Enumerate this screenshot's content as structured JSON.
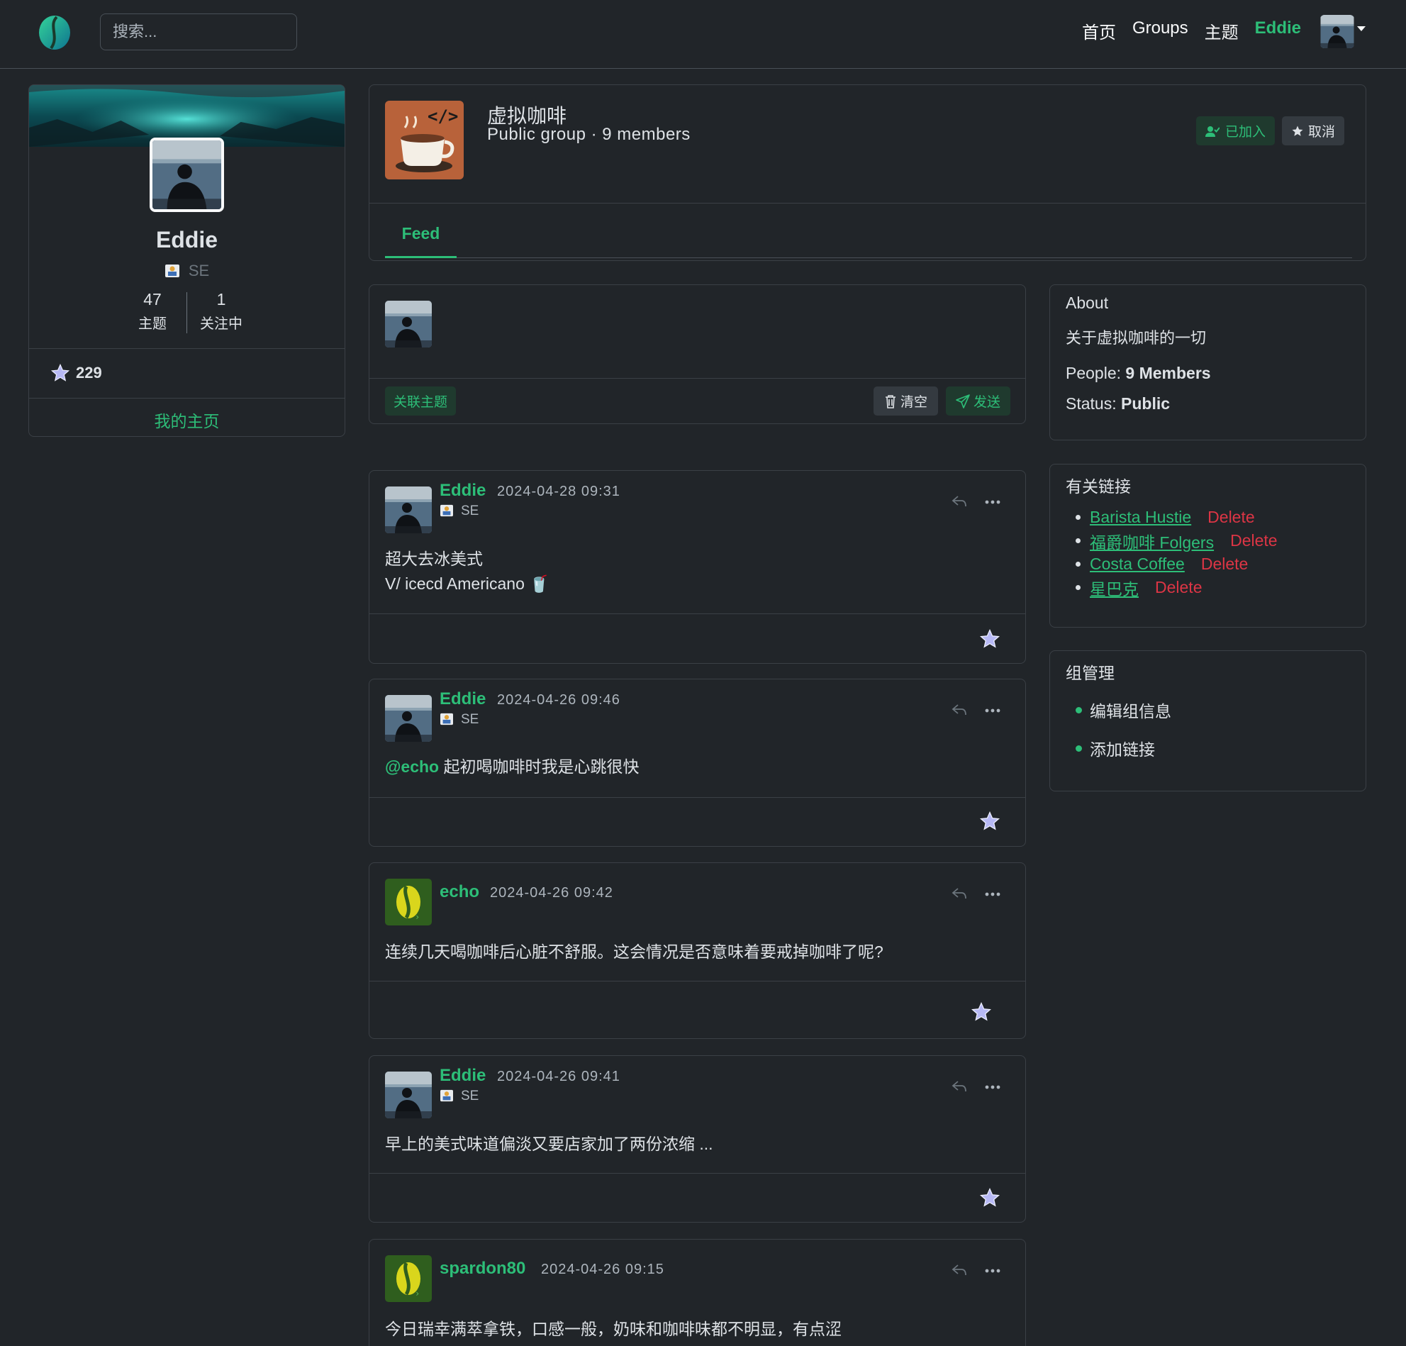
{
  "nav": {
    "search_placeholder": "搜索...",
    "links": [
      "首页",
      "Groups",
      "主题",
      "Eddie"
    ]
  },
  "profile": {
    "name": "Eddie",
    "role": "SE",
    "stats": [
      {
        "value": "47",
        "label": "主题"
      },
      {
        "value": "1",
        "label": "关注中"
      }
    ],
    "stars": "229",
    "homepage_label": "我的主页"
  },
  "group": {
    "title": "虚拟咖啡",
    "subtitle": "Public group · 9 members",
    "joined_label": "已加入",
    "cancel_label": "取消",
    "tab_feed": "Feed"
  },
  "composer": {
    "topic_label": "关联主题",
    "clear_label": "清空",
    "send_label": "发送"
  },
  "posts": [
    {
      "author": "Eddie",
      "time": "2024-04-28 09:31",
      "role": "SE",
      "lines": [
        "超大去冰美式",
        "V/ icecd Americano 🥤"
      ]
    },
    {
      "author": "Eddie",
      "time": "2024-04-26 09:46",
      "role": "SE",
      "mention": "@echo",
      "text": "起初喝咖啡时我是心跳很快"
    },
    {
      "author": "echo",
      "time": "2024-04-26 09:42",
      "text": "连续几天喝咖啡后心脏不舒服。这会情况是否意味着要戒掉咖啡了呢?"
    },
    {
      "author": "Eddie",
      "time": "2024-04-26 09:41",
      "role": "SE",
      "text": "早上的美式味道偏淡又要店家加了两份浓缩 ..."
    },
    {
      "author": "spardon80",
      "time": "2024-04-26 09:15",
      "text": "今日瑞幸满萃拿铁，口感一般，奶味和咖啡味都不明显，有点涩"
    }
  ],
  "about": {
    "title": "About",
    "description": "关于虚拟咖啡的一切",
    "people_label": "People:",
    "people_value": "9 Members",
    "status_label": "Status:",
    "status_value": "Public"
  },
  "links": {
    "title": "有关链接",
    "delete_label": "Delete",
    "items": [
      "Barista Hustie",
      "福爵咖啡 Folgers",
      "Costa Coffee",
      "星巴克"
    ]
  },
  "admin": {
    "title": "组管理",
    "items": [
      "编辑组信息",
      "添加链接"
    ]
  },
  "colors": {
    "accent": "#2dbe78",
    "danger": "#dc3545",
    "background": "#212529"
  }
}
